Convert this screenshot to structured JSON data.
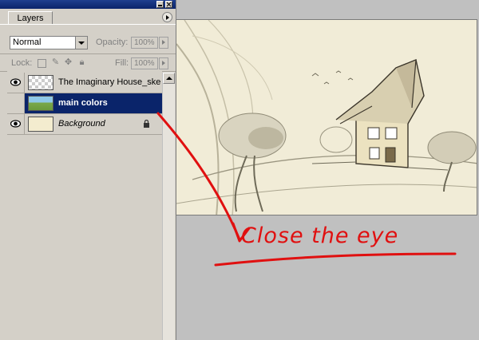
{
  "palette": {
    "tab_label": "Layers",
    "blend_mode": "Normal",
    "opacity_label": "Opacity:",
    "opacity_value": "100%",
    "lock_label": "Lock:",
    "fill_label": "Fill:",
    "fill_value": "100%"
  },
  "layers": [
    {
      "name": "The Imaginary House_sket...",
      "visible": true,
      "selected": false
    },
    {
      "name": "main colors",
      "visible": false,
      "selected": true
    },
    {
      "name": "Background",
      "visible": true,
      "selected": false,
      "locked": true
    }
  ],
  "annotation": {
    "text": "Close the eye",
    "color": "#e01010"
  },
  "colors": {
    "selection": "#0a246a",
    "panel": "#d4d0c8",
    "workspace": "#c0c0c0",
    "paper": "#f1ecd7"
  }
}
